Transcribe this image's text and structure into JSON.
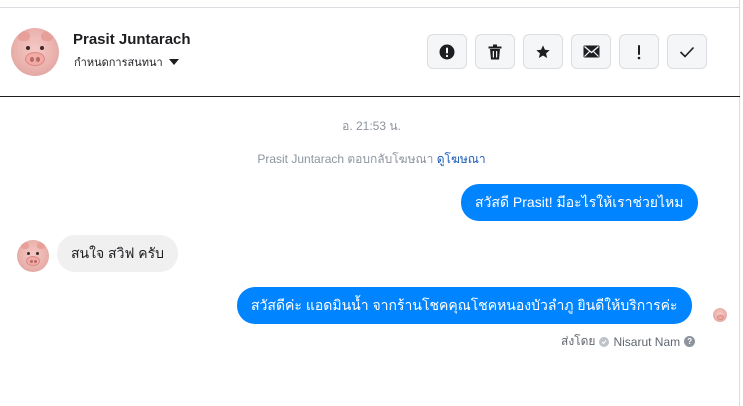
{
  "header": {
    "contact_name": "Prasit Juntarach",
    "conversation_menu_label": "กำหนดการสนทนา",
    "actions": [
      {
        "icon": "alert-circle-icon"
      },
      {
        "icon": "trash-icon"
      },
      {
        "icon": "star-icon"
      },
      {
        "icon": "envelope-icon"
      },
      {
        "icon": "exclamation-icon"
      },
      {
        "icon": "check-icon"
      }
    ]
  },
  "thread": {
    "timestamp": "อ. 21:53 น.",
    "ad_notice": {
      "text": "Prasit Juntarach ตอบกลับโฆษณา",
      "link": "ดูโฆษณา"
    },
    "messages": [
      {
        "direction": "outgoing",
        "text": "สวัสดี Prasit! มีอะไรให้เราช่วยไหม"
      },
      {
        "direction": "incoming",
        "text": "สนใจ สวิฟ ครับ"
      },
      {
        "direction": "outgoing",
        "text": "สวัสดีค่ะ แอดมินน้ำ จากร้านโชคคุณโชคหนองบัวลำภู ยินดีให้บริการค่ะ"
      }
    ],
    "sent_by": {
      "prefix": "ส่งโดย",
      "name": "Nisarut Nam",
      "help_icon_text": "?"
    }
  },
  "colors": {
    "outgoing_bubble": "#0084ff",
    "incoming_bubble": "#f1f0f0",
    "link": "#1c5bb8"
  }
}
